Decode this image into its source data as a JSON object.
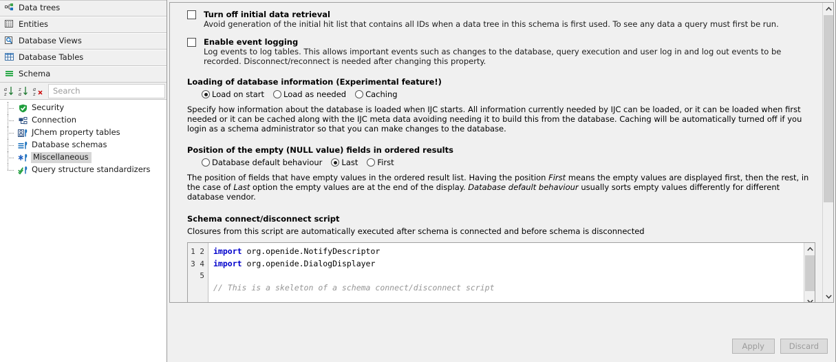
{
  "explorer": {
    "panels": [
      {
        "label": "Data trees",
        "icon": "data-tree-icon"
      },
      {
        "label": "Entities",
        "icon": "entities-grid-icon"
      },
      {
        "label": "Database Views",
        "icon": "database-view-magnifier-icon"
      },
      {
        "label": "Database Tables",
        "icon": "database-table-icon"
      },
      {
        "label": "Schema",
        "icon": "schema-lines-icon"
      }
    ],
    "toolbar": {
      "sort_asc": "a-z-sort-ascending-icon",
      "sort_desc": "z-a-sort-descending-icon",
      "sort_none": "a-z-sort-remove-icon",
      "search_placeholder": "Search"
    },
    "tree_items": [
      {
        "label": "Security",
        "icon": "shield-icon",
        "selected": false
      },
      {
        "label": "Connection",
        "icon": "connection-icon",
        "selected": false
      },
      {
        "label": "JChem property tables",
        "icon": "jchem-property-tables-icon",
        "selected": false
      },
      {
        "label": "Database schemas",
        "icon": "database-schemas-icon",
        "selected": false
      },
      {
        "label": "Miscellaneous",
        "icon": "miscellaneous-asterisk-icon",
        "selected": true
      },
      {
        "label": "Query structure standardizers",
        "icon": "query-standardizers-icon",
        "selected": false
      }
    ]
  },
  "main": {
    "options": [
      {
        "title": "Turn off initial data retrieval",
        "checked": false,
        "description": "Avoid generation of the initial hit list that contains all IDs when a data tree in this schema is first used. To see any data a query must first be run."
      },
      {
        "title": "Enable event logging",
        "checked": false,
        "description": "Log events to log tables. This allows important events such as changes to the database, query execution and user log in and log out events to be recorded. Disconnect/reconnect is needed after changing this property."
      }
    ],
    "loading_section": {
      "title": "Loading of database information (Experimental feature!)",
      "options": [
        {
          "label": "Load on start",
          "selected": true
        },
        {
          "label": "Load as needed",
          "selected": false
        },
        {
          "label": "Caching",
          "selected": false
        }
      ],
      "description": "Specify how information about the database is loaded when IJC starts. All information currently needed by IJC can be loaded, or it can be loaded when first needed or it can be cached along with the IJC meta data avoiding needing it to build this from the database. Caching will be automatically turned off if you login as a schema administrator so that you can make changes to the database."
    },
    "null_position_section": {
      "title": "Position of the empty (NULL value) fields in ordered results",
      "options": [
        {
          "label": "Database default behaviour",
          "selected": false
        },
        {
          "label": "Last",
          "selected": true
        },
        {
          "label": "First",
          "selected": false
        }
      ],
      "description_parts": [
        {
          "text": "The position of fields that have empty values in the ordered result list. Having the position ",
          "italic": false
        },
        {
          "text": "First",
          "italic": true
        },
        {
          "text": " means the empty values are displayed first, then the rest, in the case of ",
          "italic": false
        },
        {
          "text": "Last",
          "italic": true
        },
        {
          "text": " option the empty values are at the end of the display. ",
          "italic": false
        },
        {
          "text": "Database default behaviour",
          "italic": true
        },
        {
          "text": " usually sorts empty values differently for different database vendor.",
          "italic": false
        }
      ]
    },
    "script_section": {
      "title": "Schema connect/disconnect script",
      "description": "Closures from this script are automatically executed after schema is connected and before schema is disconnected",
      "line_numbers": "1\n2\n3\n4\n5",
      "code_lines": [
        {
          "segments": [
            {
              "text": "import",
              "type": "kw"
            },
            {
              "text": " org.openide.NotifyDescriptor",
              "type": "plain"
            }
          ]
        },
        {
          "segments": [
            {
              "text": "import",
              "type": "kw"
            },
            {
              "text": " org.openide.DialogDisplayer",
              "type": "plain"
            }
          ]
        },
        {
          "segments": [
            {
              "text": "",
              "type": "plain"
            }
          ]
        },
        {
          "segments": [
            {
              "text": "// This is a skeleton of a schema connect/disconnect script",
              "type": "cmt"
            }
          ]
        },
        {
          "segments": [
            {
              "text": "",
              "type": "plain"
            }
          ]
        }
      ]
    }
  },
  "footer": {
    "apply_label": "Apply",
    "discard_label": "Discard"
  },
  "icons": {
    "scroll_up": "▲",
    "scroll_down": "▼"
  }
}
